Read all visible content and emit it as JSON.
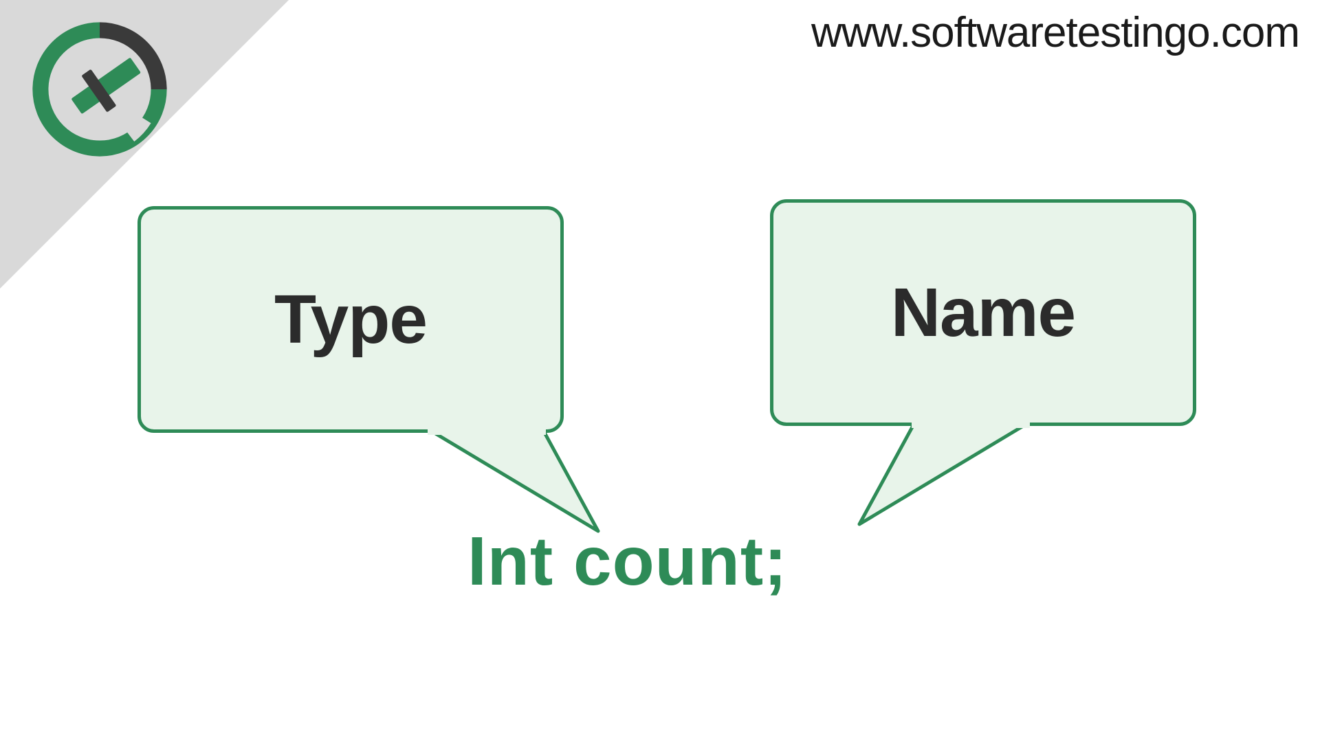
{
  "header": {
    "url": "www.softwaretestingo.com"
  },
  "diagram": {
    "bubble_left": "Type",
    "bubble_right": "Name",
    "code": "Int  count;"
  },
  "colors": {
    "green": "#2e8b57",
    "light_green": "#e8f4ea",
    "dark_gray": "#3a3a3a",
    "light_gray": "#d9d9d9"
  }
}
